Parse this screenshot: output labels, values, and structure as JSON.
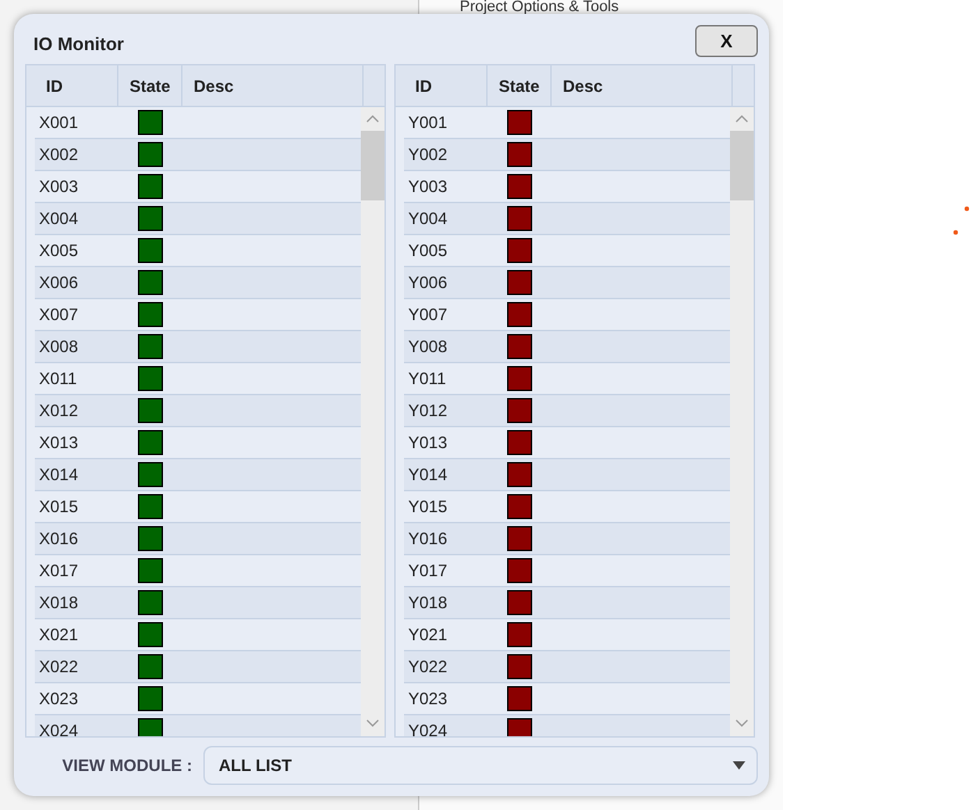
{
  "background": {
    "tree_item": "Project Options & Tools"
  },
  "dialog": {
    "title": "IO Monitor",
    "close_button": "X",
    "tables": [
      {
        "columns": [
          "ID",
          "State",
          "Desc"
        ],
        "rows": [
          {
            "id": "X001",
            "on": true
          },
          {
            "id": "X002",
            "on": true
          },
          {
            "id": "X003",
            "on": true
          },
          {
            "id": "X004",
            "on": true
          },
          {
            "id": "X005",
            "on": true
          },
          {
            "id": "X006",
            "on": true
          },
          {
            "id": "X007",
            "on": true
          },
          {
            "id": "X008",
            "on": true
          },
          {
            "id": "X011",
            "on": true
          },
          {
            "id": "X012",
            "on": true
          },
          {
            "id": "X013",
            "on": true
          },
          {
            "id": "X014",
            "on": true
          },
          {
            "id": "X015",
            "on": true
          },
          {
            "id": "X016",
            "on": true
          },
          {
            "id": "X017",
            "on": true
          },
          {
            "id": "X018",
            "on": true
          },
          {
            "id": "X021",
            "on": true
          },
          {
            "id": "X022",
            "on": true
          },
          {
            "id": "X023",
            "on": true
          },
          {
            "id": "X024",
            "on": true
          }
        ]
      },
      {
        "columns": [
          "ID",
          "State",
          "Desc"
        ],
        "rows": [
          {
            "id": "Y001",
            "on": false
          },
          {
            "id": "Y002",
            "on": false
          },
          {
            "id": "Y003",
            "on": false
          },
          {
            "id": "Y004",
            "on": false
          },
          {
            "id": "Y005",
            "on": false
          },
          {
            "id": "Y006",
            "on": false
          },
          {
            "id": "Y007",
            "on": false
          },
          {
            "id": "Y008",
            "on": false
          },
          {
            "id": "Y011",
            "on": false
          },
          {
            "id": "Y012",
            "on": false
          },
          {
            "id": "Y013",
            "on": false
          },
          {
            "id": "Y014",
            "on": false
          },
          {
            "id": "Y015",
            "on": false
          },
          {
            "id": "Y016",
            "on": false
          },
          {
            "id": "Y017",
            "on": false
          },
          {
            "id": "Y018",
            "on": false
          },
          {
            "id": "Y021",
            "on": false
          },
          {
            "id": "Y022",
            "on": false
          },
          {
            "id": "Y023",
            "on": false
          },
          {
            "id": "Y024",
            "on": false
          }
        ]
      }
    ],
    "view_module": {
      "label": "VIEW MODULE :",
      "value": "ALL LIST"
    }
  }
}
